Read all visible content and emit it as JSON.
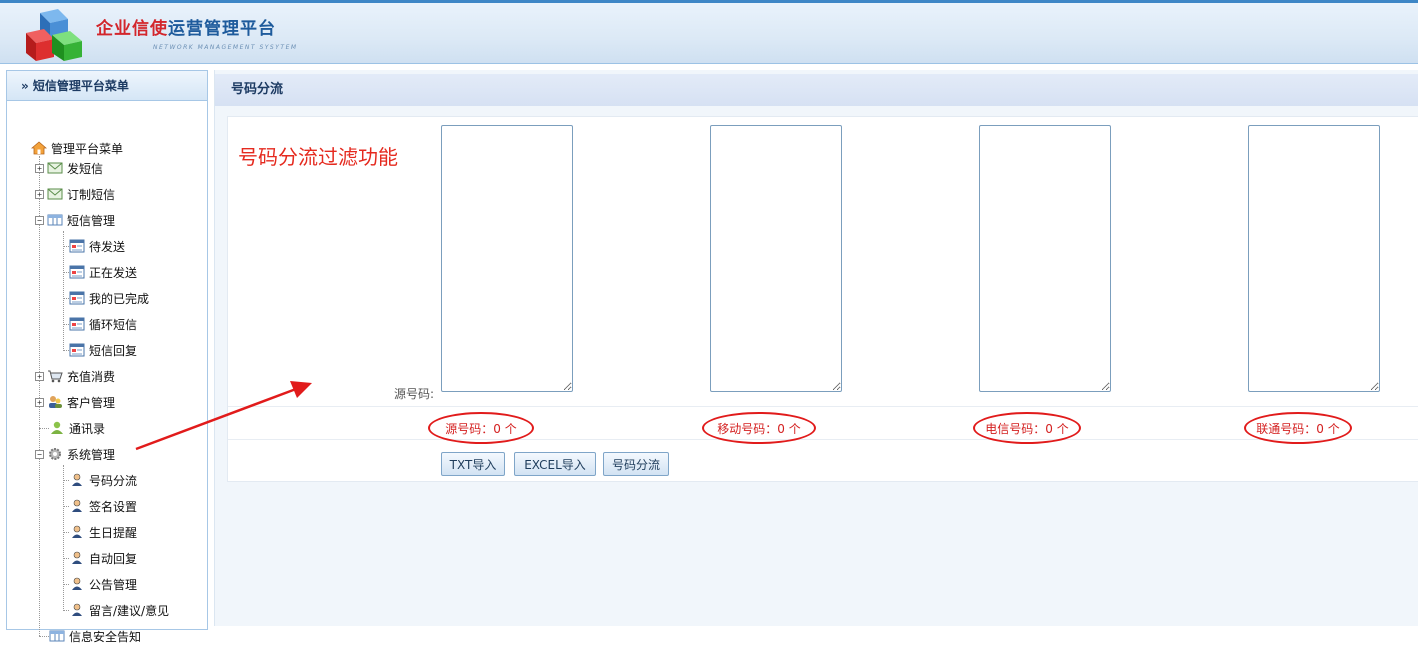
{
  "header": {
    "title_part1": "企业信使",
    "title_part2": "运营管理平台",
    "subtitle": "NETWORK MANAGEMENT SYSYTEM"
  },
  "sidebar": {
    "heading": "» 短信管理平台菜单",
    "root": "管理平台菜单",
    "items": {
      "send_sms": "发短信",
      "subscribe_sms": "订制短信",
      "sms_manage": "短信管理",
      "pending": "待发送",
      "sending": "正在发送",
      "completed": "我的已完成",
      "cycle": "循环短信",
      "reply": "短信回复",
      "recharge": "充值消费",
      "customer": "客户管理",
      "contacts": "通讯录",
      "system": "系统管理",
      "number_split": "号码分流",
      "signature": "签名设置",
      "birthday": "生日提醒",
      "auto_reply": "自动回复",
      "notice": "公告管理",
      "feedback": "留言/建议/意见",
      "security": "信息安全告知"
    }
  },
  "main": {
    "page_title": "号码分流",
    "feature_title": "号码分流过滤功能",
    "source_label": "源号码:",
    "boxes": {
      "source_value": "",
      "mobile_value": "",
      "telecom_value": "",
      "unicom_value": ""
    },
    "counts": {
      "source": "源号码：0 个",
      "mobile": "移动号码：0 个",
      "telecom": "电信号码：0 个",
      "unicom": "联通号码：0 个"
    },
    "buttons": {
      "txt_import": "TXT导入",
      "excel_import": "EXCEL导入",
      "split": "号码分流"
    }
  },
  "colors": {
    "accent": "#3d86c6",
    "highlight_red": "#e11b1b",
    "title_red": "#d3262c",
    "title_blue": "#1e5b9c"
  },
  "icons": [
    "logo-cube-icon",
    "home-icon",
    "envelope-icon",
    "table-icon",
    "calendar-icon",
    "cart-icon",
    "users-icon",
    "person-icon",
    "gear-icon",
    "user-icon"
  ]
}
